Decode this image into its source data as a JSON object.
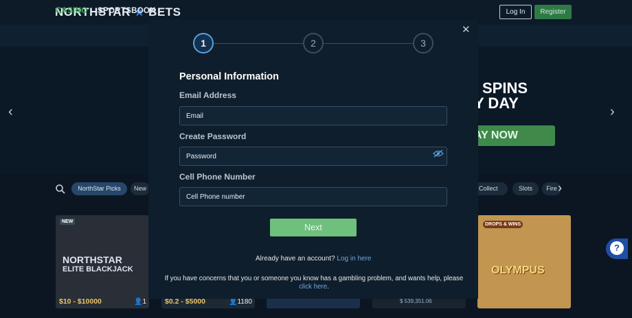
{
  "header": {
    "logo_left": "NORTHSTAR",
    "logo_star": "★",
    "logo_right": "BETS",
    "login_label": "Log In",
    "register_label": "Register"
  },
  "nav": {
    "casino": "CASINO",
    "sportsbook": "SPORTSBOOK"
  },
  "banner": {
    "line1": "SPINS",
    "line2": "Y DAY",
    "cta": "AY NOW",
    "arrow_left": "‹",
    "arrow_right": "›"
  },
  "filters": {
    "chips": [
      "NorthStar Picks",
      "New",
      "h Collect",
      "Slots",
      "Fire"
    ],
    "next_arrow": "›"
  },
  "cards": [
    {
      "badge": "NEW",
      "title_line1": "NORTHSTAR",
      "title_line2": "ELITE BLACKJACK",
      "price": "$10 - $10000",
      "count": "1"
    },
    {
      "price": "$0.2 - $5000",
      "count": "1180"
    },
    {},
    {
      "value": "$ 539,351.06"
    },
    {
      "badge": "DROPS & WINS",
      "title": "OLYMPUS"
    }
  ],
  "modal": {
    "steps": [
      "1",
      "2",
      "3"
    ],
    "active_step": 1,
    "close_icon": "✕",
    "heading": "Personal Information",
    "email_label": "Email Address",
    "email_placeholder": "Email",
    "password_label": "Create Password",
    "password_placeholder": "Password",
    "phone_label": "Cell Phone Number",
    "phone_placeholder": "Cell Phone number",
    "next_label": "Next",
    "already_text": "Already have an account?",
    "login_link": "Log in here",
    "concern_text": "If you have concerns that you or someone you know has a gambling problem, and wants help, please",
    "click_here": "click here",
    "period": "."
  },
  "help": {
    "icon": "?"
  },
  "colors": {
    "accent_green": "#3fae5c",
    "next_button": "#6fbf7d",
    "link_blue": "#6aa9e6",
    "step_active": "#5aa0de"
  }
}
